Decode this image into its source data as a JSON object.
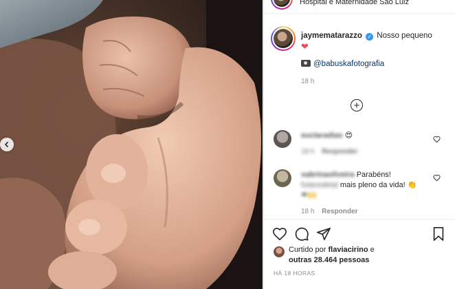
{
  "post": {
    "location": "Hospital e Maternidade São Luiz",
    "author": "jaymematarazzo",
    "caption_text": "Nosso pequeno",
    "caption_emoji": "❤",
    "credit_emoji": "camera-icon",
    "credit_mention": "@babuskafotografia",
    "caption_time": "18 h"
  },
  "comments": [
    {
      "username": "euclaradias",
      "text": "😍",
      "time": "18 h",
      "reply_label": "Responder"
    },
    {
      "username": "sabrinaoliveira",
      "text_line1": "Parabéns!",
      "blurred_name": "fulanodetal",
      "text_line2": "mais pleno da vida! 👏",
      "emojis": "❤🙌",
      "time": "18 h",
      "reply_label": "Responder"
    }
  ],
  "likes": {
    "prefix": "Curtido por",
    "liker": "flaviacirino",
    "and_word": "e",
    "others": "outras 28.464 pessoas"
  },
  "posted_ago": "HÁ 18 HORAS",
  "icons": [
    "prev-arrow-icon",
    "verified-icon",
    "add-circle-icon",
    "heart-icon",
    "comment-icon",
    "share-icon",
    "bookmark-icon"
  ],
  "colors": {
    "link": "#00376b",
    "verified": "#3897f0",
    "meta": "#8e8e8e",
    "heart": "#ed4956"
  }
}
